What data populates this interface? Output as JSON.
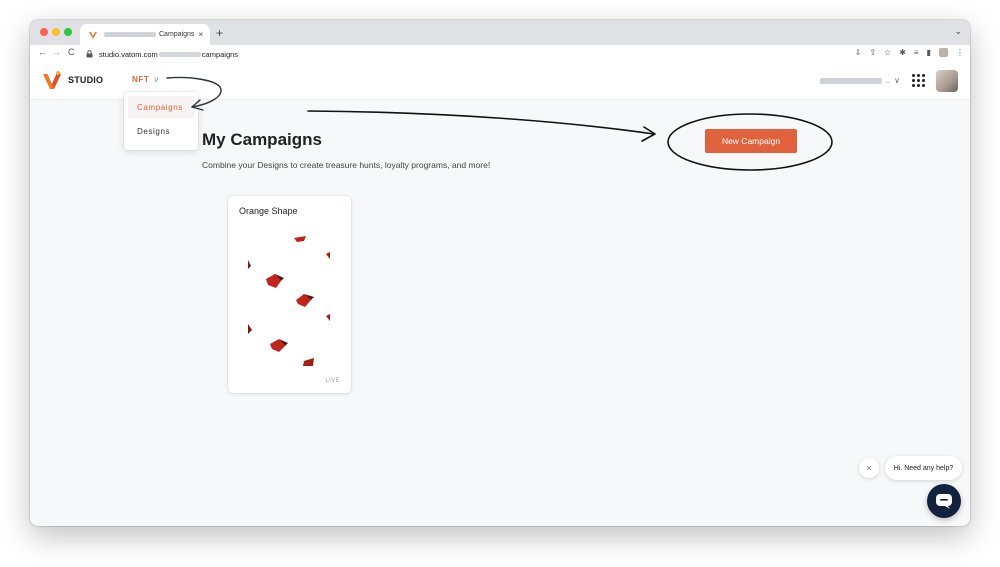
{
  "browser": {
    "tab_title": "Campaigns",
    "tab_close": "×",
    "new_tab": "+",
    "tab_menu": "⌄",
    "url_prefix": "studio.vatom.com",
    "url_suffix": "campaigns",
    "nav_back": "←",
    "nav_forward": "→",
    "nav_reload": "C"
  },
  "header": {
    "brand": "STUDIO",
    "menu_label": "NFT",
    "menu_chevron": "∨",
    "account_ellipsis": "..",
    "account_chevron": "∨"
  },
  "dropdown": {
    "items": [
      {
        "label": "Campaigns",
        "active": true
      },
      {
        "label": "Designs",
        "active": false
      }
    ]
  },
  "main": {
    "title": "My Campaigns",
    "subtitle": "Combine your Designs to create treasure hunts, loyalty programs, and more!",
    "new_button": "New Campaign"
  },
  "cards": [
    {
      "title": "Orange Shape",
      "status": "LIVE"
    }
  ],
  "chat": {
    "greeting": "Hi. Need any help?",
    "dismiss": "×"
  },
  "colors": {
    "accent": "#e0623c",
    "chat_launcher": "#13223f"
  }
}
